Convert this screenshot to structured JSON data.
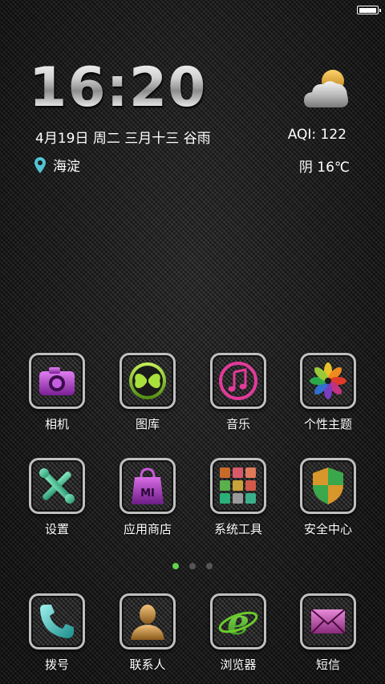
{
  "status_bar": {
    "battery_level": 1.0
  },
  "widget": {
    "time": "16:20",
    "date_line": "4月19日  周二  三月十三 谷雨",
    "aqi": "AQI: 122",
    "location": "海淀",
    "condition": "阴  16℃",
    "weather_icon": "cloud-sun-icon"
  },
  "apps_row1": [
    {
      "label": "相机",
      "icon": "camera-icon"
    },
    {
      "label": "图库",
      "icon": "gallery-butterfly-icon"
    },
    {
      "label": "音乐",
      "icon": "music-note-icon"
    },
    {
      "label": "个性主题",
      "icon": "themes-flower-icon"
    }
  ],
  "apps_row2": [
    {
      "label": "设置",
      "icon": "settings-tools-icon"
    },
    {
      "label": "应用商店",
      "icon": "store-bag-icon"
    },
    {
      "label": "系统工具",
      "icon": "system-tools-grid-icon"
    },
    {
      "label": "安全中心",
      "icon": "security-shield-icon"
    }
  ],
  "page_indicator": {
    "pages": 3,
    "current": 1
  },
  "dock": [
    {
      "label": "拨号",
      "icon": "phone-icon"
    },
    {
      "label": "联系人",
      "icon": "contacts-person-icon"
    },
    {
      "label": "浏览器",
      "icon": "browser-e-icon"
    },
    {
      "label": "短信",
      "icon": "message-envelope-icon"
    }
  ],
  "colors": {
    "indicator_active": "#62d34c",
    "indicator_inactive": "#555555"
  }
}
